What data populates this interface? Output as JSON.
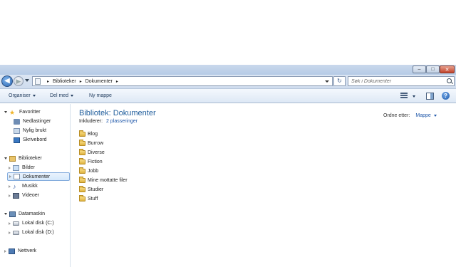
{
  "window_controls": {
    "minimize": "–",
    "maximize": "□",
    "close": "✕"
  },
  "address_bar": {
    "breadcrumbs": [
      "Biblioteker",
      "Dokumenter"
    ],
    "separator": "▸",
    "refresh": "↻",
    "search_placeholder": "Søk i Dokumenter"
  },
  "toolbar": {
    "organize": "Organiser",
    "share": "Del med",
    "new_folder": "Ny mappe",
    "help": "?"
  },
  "nav": {
    "favorites": "Favoritter",
    "downloads": "Nedlastinger",
    "recent": "Nylig brukt",
    "desktop": "Skrivebord",
    "libraries": "Biblioteker",
    "pictures": "Bilder",
    "documents": "Dokumenter",
    "music": "Musikk",
    "videos": "Videoer",
    "computer": "Datamaskin",
    "disk_c": "Lokal disk (C:)",
    "disk_d": "Lokal disk (D:)",
    "network": "Nettverk"
  },
  "content": {
    "title": "Bibliotek: Dokumenter",
    "includes_label": "Inkluderer:",
    "includes_link": "2 plasseringer",
    "arrange_label": "Ordne etter:",
    "arrange_value": "Mappe",
    "folders": [
      "Blog",
      "Burrow",
      "Diverse",
      "Fiction",
      "Jobb",
      "Mine mottatte filer",
      "Studier",
      "Stuff"
    ]
  },
  "colors": {
    "title_blue": "#1e5c9b",
    "link_blue": "#1c55a8",
    "selection_border": "#84acdd",
    "folder_yellow": "#dfb340"
  }
}
